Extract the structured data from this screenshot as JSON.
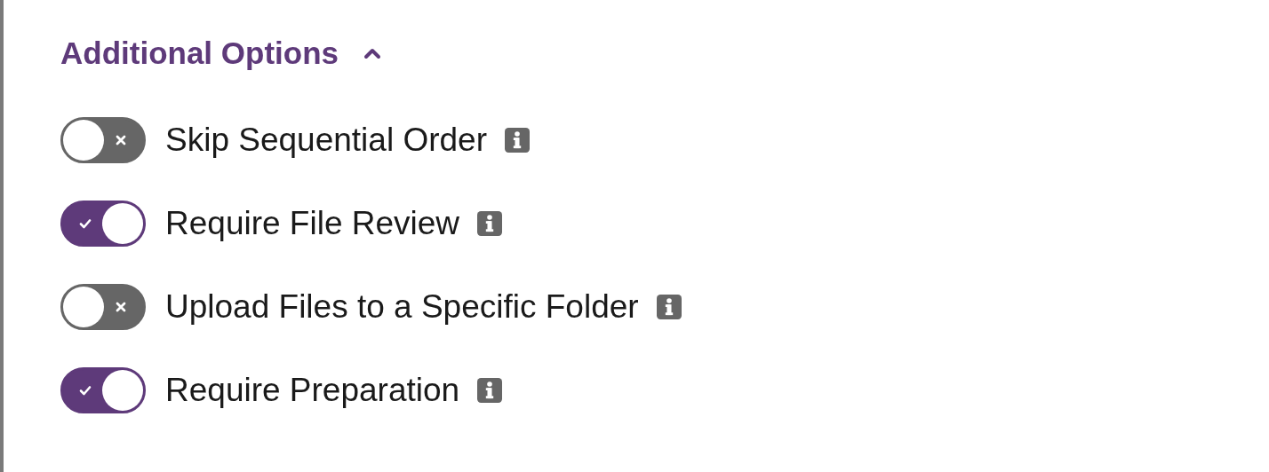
{
  "section": {
    "title": "Additional Options",
    "expanded": true
  },
  "options": [
    {
      "label": "Skip Sequential Order",
      "on": false
    },
    {
      "label": "Require File Review",
      "on": true
    },
    {
      "label": "Upload Files to a Specific Folder",
      "on": false
    },
    {
      "label": "Require Preparation",
      "on": true
    }
  ]
}
